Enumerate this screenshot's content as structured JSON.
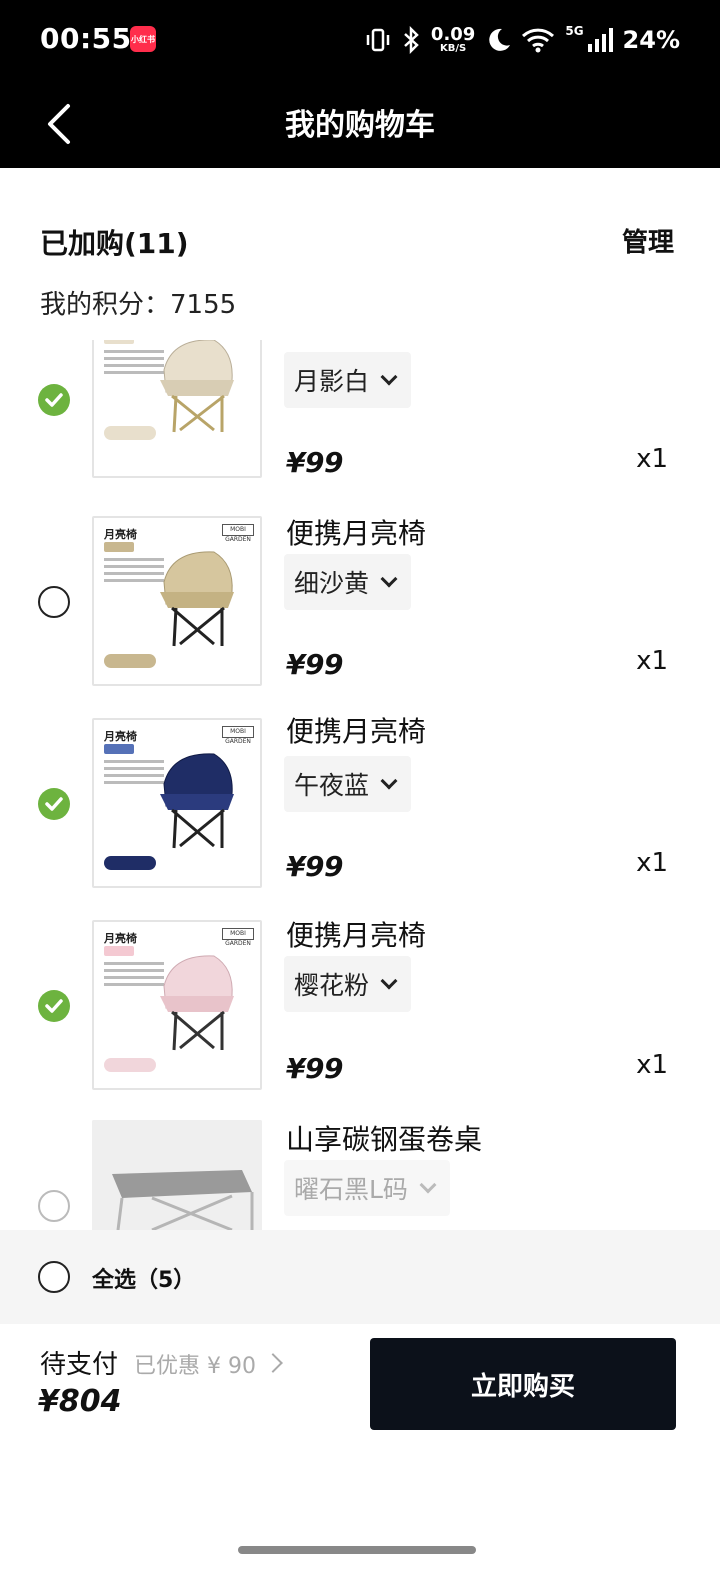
{
  "status_bar": {
    "time": "00:55",
    "app_badge": "小红书",
    "net_speed": "0.09",
    "net_unit": "KB/S",
    "signal_tag": "5G",
    "battery": "24%"
  },
  "header": {
    "title": "我的购物车"
  },
  "summary": {
    "title": "已加购(11)",
    "manage_label": "管理",
    "points": "我的积分：7155"
  },
  "items": [
    {
      "name": "",
      "variant": "月影白",
      "price": "¥99",
      "qty": "x1",
      "checked": true,
      "color": "#e8dfcc",
      "tag_color": "#e8dfcc"
    },
    {
      "name": "便携月亮椅",
      "variant": "细沙黄",
      "price": "¥99",
      "qty": "x1",
      "checked": false,
      "color": "#d6c69e",
      "tag_color": "#c8b78f",
      "thumb_title": "月亮椅"
    },
    {
      "name": "便携月亮椅",
      "variant": "午夜蓝",
      "price": "¥99",
      "qty": "x1",
      "checked": true,
      "color": "#1f2d66",
      "tag_color": "#5571b7",
      "thumb_title": "月亮椅"
    },
    {
      "name": "便携月亮椅",
      "variant": "樱花粉",
      "price": "¥99",
      "qty": "x1",
      "checked": true,
      "color": "#f1d6db",
      "tag_color": "#f4c9d2",
      "thumb_title": "月亮椅"
    },
    {
      "name": "山享碳钢蛋卷桌",
      "variant": "曜石黑L码",
      "checked": false,
      "color": "#9a9a9a"
    }
  ],
  "thumb_brand": "MOBI GARDEN",
  "select_all": {
    "label": "全选（5）"
  },
  "footer": {
    "pay_label": "待支付",
    "discount": "已优惠 ¥ 90",
    "total": "¥804",
    "buy_label": "立即购买"
  },
  "colors": {
    "check_on": "#6db33f",
    "buy_button": "#0c111a"
  }
}
